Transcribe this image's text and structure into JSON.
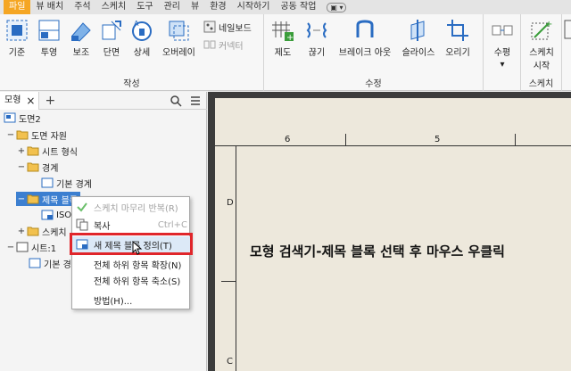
{
  "tabs": [
    "파일",
    "뷰 배치",
    "주석",
    "스케치",
    "도구",
    "관리",
    "뷰",
    "환경",
    "시작하기",
    "공동 작업"
  ],
  "tab_extra": "▣ ▾",
  "ribbon": {
    "create_group": "작성",
    "modify_group": "수정",
    "sketch_group": "스케치",
    "buttons": {
      "base": "기준",
      "projected": "투영",
      "auxiliary": "보조",
      "section": "단면",
      "detail": "상세",
      "overlay": "오버레이",
      "nailboard": "네일보드",
      "connector": "커넥터",
      "draft": "제도",
      "break": "끊기",
      "break_out": "브레이크 아웃",
      "slice": "슬라이스",
      "crop": "오리기",
      "horizontal": "수평",
      "start_sketch_1": "스케치",
      "start_sketch_2": "시작"
    }
  },
  "browser": {
    "tab_label": "모형",
    "tree": [
      "도면2",
      "도면 자원",
      "시트 형식",
      "경계",
      "기본 경계",
      "제목 블록",
      "ISO",
      "스케치",
      "시트:1",
      "기본 경"
    ]
  },
  "sheet": {
    "ruler_top": [
      "6",
      "5"
    ],
    "ruler_left": [
      "D",
      "C"
    ],
    "annotation": "모형 검색기-제목 블록 선택 후 마우스 우클릭"
  },
  "context_menu": {
    "items": [
      {
        "label": "스케치 마무리 반복(R)",
        "shortcut": ""
      },
      {
        "label": "복사",
        "shortcut": "Ctrl+C"
      },
      {
        "label": "새 제목 블록 정의(T)",
        "shortcut": ""
      },
      {
        "label": "전체 하위 항목 확장(N)",
        "shortcut": ""
      },
      {
        "label": "전체 하위 항목 축소(S)",
        "shortcut": ""
      },
      {
        "label": "방법(H)...",
        "shortcut": ""
      }
    ]
  }
}
